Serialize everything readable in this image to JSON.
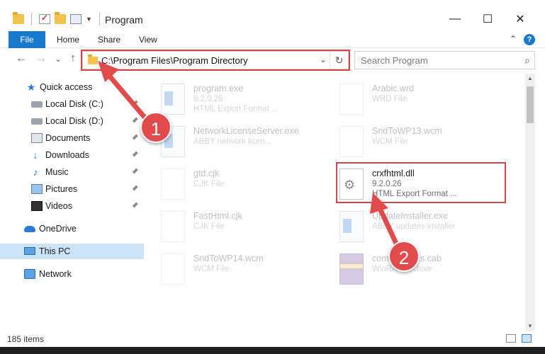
{
  "window": {
    "title": "Program",
    "minimize": "—",
    "maximize": "☐",
    "close": "✕"
  },
  "ribbon": {
    "tabs": [
      "File",
      "Home",
      "Share",
      "View"
    ],
    "help": "?",
    "collapse": "⌃"
  },
  "nav": {
    "back": "←",
    "forward": "→",
    "recent": "⌄",
    "up": "↑",
    "address_path": "C:\\Program Files\\Program Directory",
    "address_dropdown": "⌄",
    "refresh": "↻",
    "search_placeholder": "Search Program",
    "search_icon": "⌕"
  },
  "sidebar": {
    "items": [
      {
        "label": "Quick access",
        "icon": "star-icon"
      },
      {
        "label": "Local Disk (C:)",
        "icon": "disk-icon"
      },
      {
        "label": "Local Disk (D:)",
        "icon": "disk-icon"
      },
      {
        "label": "Documents",
        "icon": "documents-icon"
      },
      {
        "label": "Downloads",
        "icon": "downloads-icon"
      },
      {
        "label": "Music",
        "icon": "music-icon"
      },
      {
        "label": "Pictures",
        "icon": "pictures-icon"
      },
      {
        "label": "Videos",
        "icon": "videos-icon"
      },
      {
        "label": "OneDrive",
        "icon": "cloud-icon"
      },
      {
        "label": "This PC",
        "icon": "pc-icon"
      },
      {
        "label": "Network",
        "icon": "network-icon"
      }
    ],
    "pin": "📌",
    "selected": "This PC"
  },
  "files": [
    {
      "name": "program.exe",
      "line1": "9.2.0.26",
      "line2": "HTML Export Format ..."
    },
    {
      "name": "Arabic.wrd",
      "line1": "WRD File",
      "line2": ""
    },
    {
      "name": "NetworkLicenseServer.exe",
      "line1": "ABBY network licen...",
      "line2": ""
    },
    {
      "name": "SndToWP13.wcm",
      "line1": "WCM File",
      "line2": ""
    },
    {
      "name": "gtd.cjk",
      "line1": "CJK File",
      "line2": ""
    },
    {
      "name": "crxfhtml.dll",
      "line1": "9.2.0.26",
      "line2": "HTML Export Format ..."
    },
    {
      "name": "FastHtml.cjk",
      "line1": "CJK File",
      "line2": ""
    },
    {
      "name": "UpdateInstaller.exe",
      "line1": "ABBY updates installer",
      "line2": ""
    },
    {
      "name": "SndToWP14.wcm",
      "line1": "WCM File",
      "line2": ""
    },
    {
      "name": "common-files.cab",
      "line1": "WinRAR archive",
      "line2": ""
    }
  ],
  "callouts": [
    "1",
    "2"
  ],
  "status": {
    "item_count": "185 items"
  },
  "colors": {
    "accent": "#1979ca",
    "highlight_box": "#d64545",
    "callout_fill": "#e24b4b",
    "selected_nav": "#cce4f7"
  }
}
